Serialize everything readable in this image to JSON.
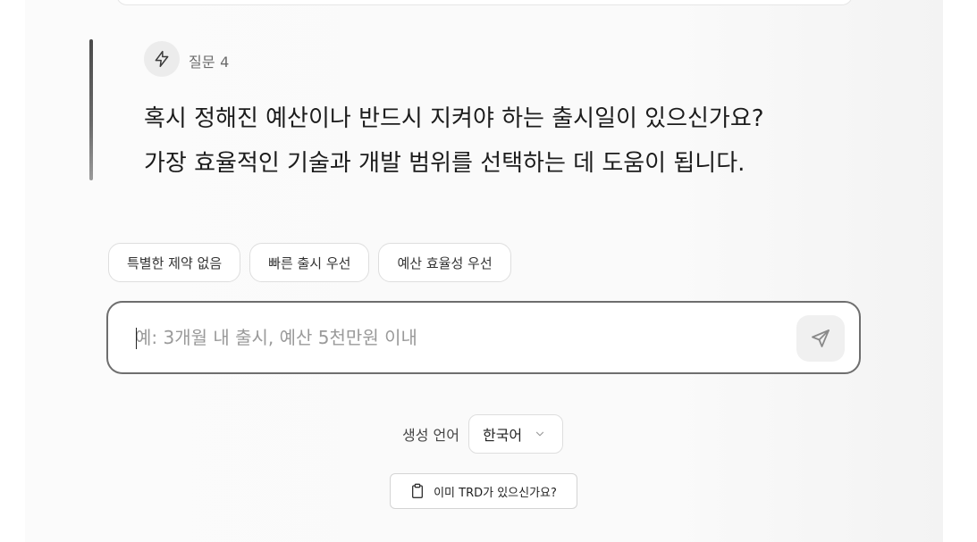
{
  "question": {
    "label": "질문 4",
    "icon": "lightning-icon",
    "line1": "혹시 정해진 예산이나 반드시 지켜야 하는 출시일이 있으신가요?",
    "line2": "가장 효율적인 기술과 개발 범위를 선택하는 데 도움이 됩니다."
  },
  "chips": [
    {
      "label": "특별한 제약 없음"
    },
    {
      "label": "빠른 출시 우선"
    },
    {
      "label": "예산 효율성 우선"
    }
  ],
  "input": {
    "placeholder": "예: 3개월 내 출시, 예산 5천만원 이내",
    "value": "",
    "send_icon": "send-icon"
  },
  "language": {
    "label": "생성 언어",
    "selected": "한국어"
  },
  "trd_button": {
    "label": "이미 TRD가 있으신가요?",
    "icon": "clipboard-icon"
  }
}
